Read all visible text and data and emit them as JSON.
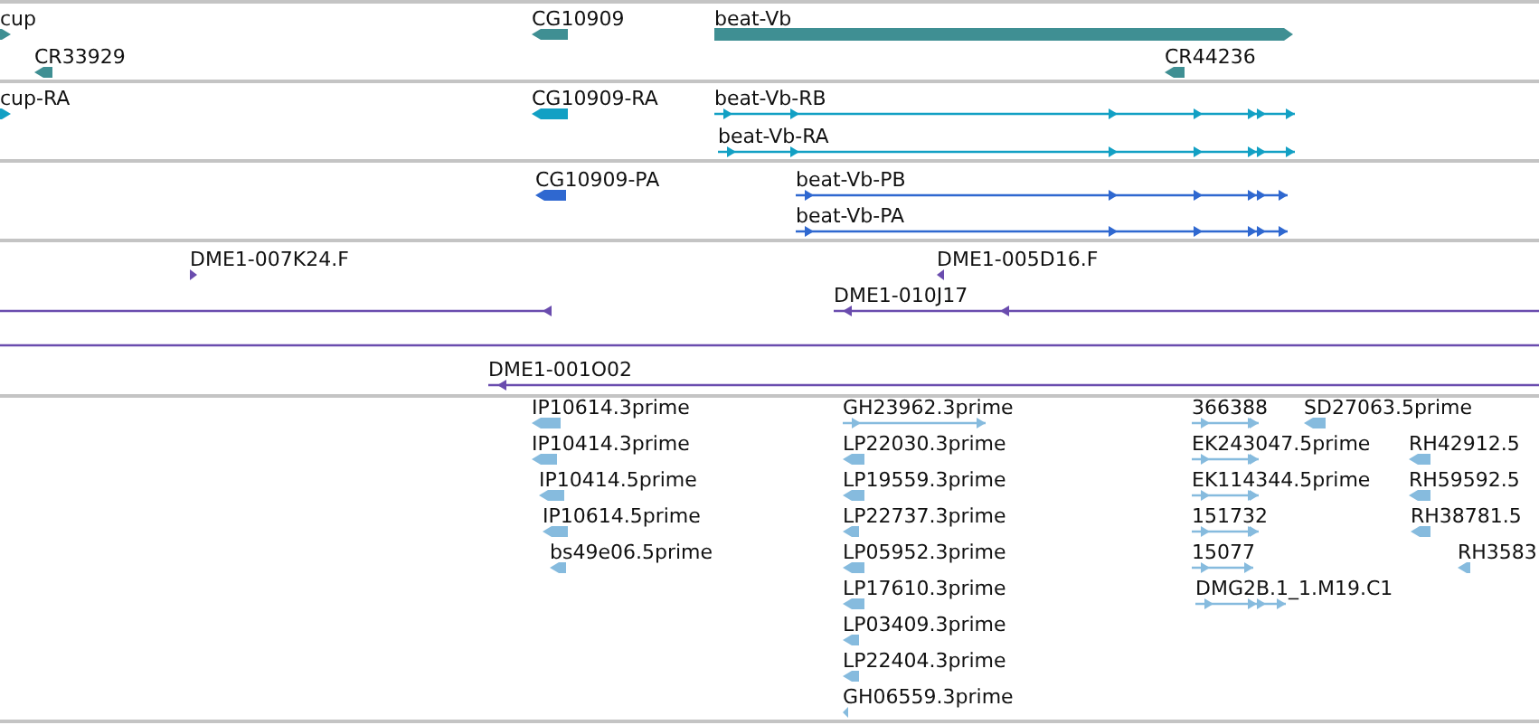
{
  "tracks": [
    {
      "kind": "gene",
      "features": [
        {
          "label": "cup",
          "reverse": false,
          "kind": "block"
        },
        {
          "label": "CR33929",
          "reverse": true,
          "kind": "block"
        },
        {
          "label": "CG10909",
          "reverse": true,
          "kind": "block"
        },
        {
          "label": "beat-Vb",
          "reverse": false,
          "kind": "block"
        },
        {
          "label": "CR44236",
          "reverse": true,
          "kind": "block"
        }
      ]
    },
    {
      "kind": "transcript",
      "features": [
        {
          "label": "cup-RA",
          "reverse": false,
          "kind": "block"
        },
        {
          "label": "CG10909-RA",
          "reverse": true,
          "kind": "block"
        },
        {
          "label": "beat-Vb-RB",
          "reverse": false,
          "kind": "line"
        },
        {
          "label": "beat-Vb-RA",
          "reverse": false,
          "kind": "line"
        }
      ]
    },
    {
      "kind": "protein",
      "features": [
        {
          "label": "CG10909-PA",
          "reverse": true,
          "kind": "block"
        },
        {
          "label": "beat-Vb-PB",
          "reverse": false,
          "kind": "line"
        },
        {
          "label": "beat-Vb-PA",
          "reverse": false,
          "kind": "line"
        }
      ]
    },
    {
      "kind": "bac",
      "features": [
        {
          "label": "DME1-007K24.F",
          "reverse": false,
          "kind": "block"
        },
        {
          "label": "DME1-005D16.F",
          "reverse": true,
          "kind": "block"
        },
        {
          "reverse": true,
          "kind": "line"
        },
        {
          "label": "DME1-010J17",
          "reverse": true,
          "kind": "line"
        },
        {
          "kind": "line"
        },
        {
          "label": "DME1-001O02",
          "reverse": true,
          "kind": "line"
        }
      ]
    },
    {
      "kind": "est",
      "features": [
        {
          "label": "IP10614.3prime",
          "reverse": true,
          "kind": "block"
        },
        {
          "label": "IP10414.3prime",
          "reverse": true,
          "kind": "block"
        },
        {
          "label": "IP10414.5prime",
          "reverse": true,
          "kind": "block"
        },
        {
          "label": "IP10614.5prime",
          "reverse": true,
          "kind": "block"
        },
        {
          "label": "bs49e06.5prime",
          "reverse": true,
          "kind": "block"
        },
        {
          "label": "GH23962.3prime",
          "reverse": false,
          "kind": "line"
        },
        {
          "label": "LP22030.3prime",
          "reverse": true,
          "kind": "block"
        },
        {
          "label": "LP19559.3prime",
          "reverse": true,
          "kind": "block"
        },
        {
          "label": "LP22737.3prime",
          "reverse": true,
          "kind": "block"
        },
        {
          "label": "LP05952.3prime",
          "reverse": true,
          "kind": "block"
        },
        {
          "label": "LP17610.3prime",
          "reverse": true,
          "kind": "block"
        },
        {
          "label": "LP03409.3prime",
          "reverse": true,
          "kind": "block"
        },
        {
          "label": "LP22404.3prime",
          "reverse": true,
          "kind": "block"
        },
        {
          "label": "GH06559.3prime",
          "reverse": true,
          "kind": "block"
        },
        {
          "label": "366388",
          "reverse": false,
          "kind": "line"
        },
        {
          "label": "SD27063.5prime",
          "reverse": true,
          "kind": "block"
        },
        {
          "label": "EK243047.5prime",
          "reverse": false,
          "kind": "line"
        },
        {
          "label": "RH42912.5",
          "reverse": true,
          "kind": "block"
        },
        {
          "label": "EK114344.5prime",
          "reverse": false,
          "kind": "line"
        },
        {
          "label": "RH59592.5",
          "reverse": true,
          "kind": "block"
        },
        {
          "label": "151732",
          "reverse": false,
          "kind": "line"
        },
        {
          "label": "RH38781.5",
          "reverse": true,
          "kind": "block"
        },
        {
          "label": "15077",
          "reverse": false,
          "kind": "line"
        },
        {
          "label": "RH3583",
          "reverse": true,
          "kind": "block"
        },
        {
          "label": "DMG2B.1_1.M19.C1",
          "reverse": false,
          "kind": "line"
        }
      ]
    }
  ]
}
